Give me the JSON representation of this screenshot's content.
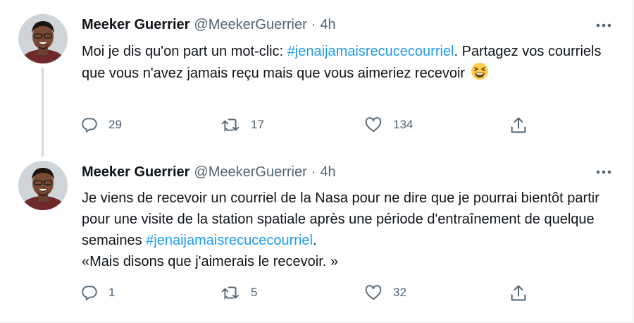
{
  "tweets": [
    {
      "author": "Meeker Guerrier",
      "handle": "@MeekerGuerrier",
      "separator": "·",
      "time": "4h",
      "text_before": "Moi je dis qu'on part un mot-clic: ",
      "hashtag": "#jenaijamaisrecucecourriel",
      "text_after": ". Partagez vos courriels que vous n'avez jamais reçu mais que vous aimeriez recevoir ",
      "emoji": "grinning-squinting-face-emoji",
      "replies": "29",
      "retweets": "17",
      "likes": "134"
    },
    {
      "author": "Meeker Guerrier",
      "handle": "@MeekerGuerrier",
      "separator": "·",
      "time": "4h",
      "text_before": "Je viens de recevoir un courriel de la Nasa pour ne dire que je pourrai bientôt partir pour une visite de la station spatiale après une période d'entraînement de quelque semaines ",
      "hashtag": "#jenaijamaisrecucecourriel",
      "text_after": ".",
      "text_line2": "«Mais disons que j'aimerais le recevoir. »",
      "replies": "1",
      "retweets": "5",
      "likes": "32"
    }
  ],
  "icons": {
    "reply": "reply-icon",
    "retweet": "retweet-icon",
    "like": "heart-icon",
    "share": "share-icon",
    "more": "more-options-icon"
  },
  "colors": {
    "hashtag": "#1d9bf0",
    "secondary_text": "#536471",
    "thread_line": "#cfd9de"
  }
}
